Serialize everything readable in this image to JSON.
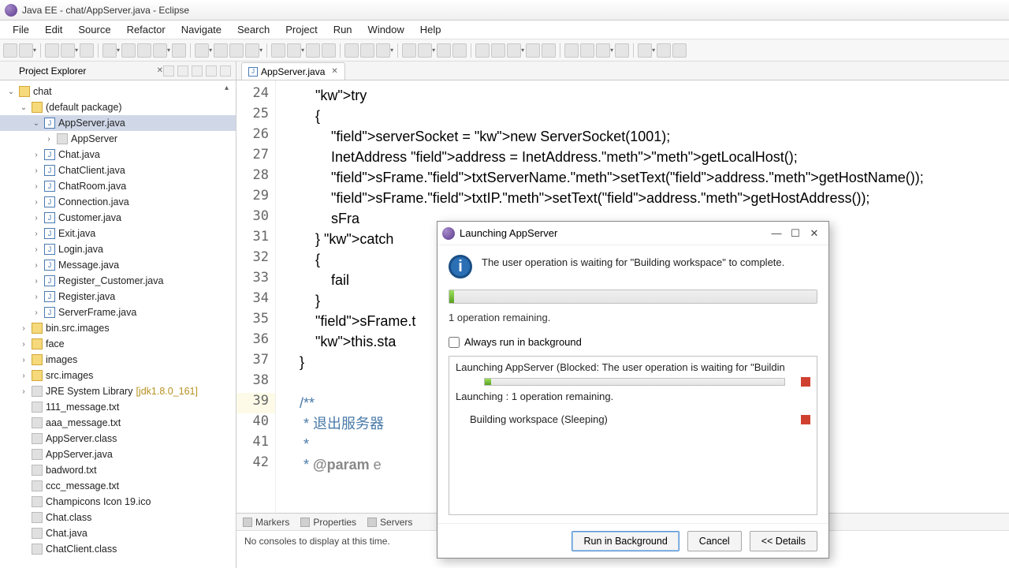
{
  "window": {
    "title": "Java EE - chat/AppServer.java - Eclipse"
  },
  "menu": [
    "File",
    "Edit",
    "Source",
    "Refactor",
    "Navigate",
    "Search",
    "Project",
    "Run",
    "Window",
    "Help"
  ],
  "sidebar": {
    "title": "Project Explorer",
    "tree": [
      {
        "d": 0,
        "tw": "v",
        "t": "folder",
        "lbl": "chat"
      },
      {
        "d": 1,
        "tw": "v",
        "t": "folder",
        "lbl": "(default package)"
      },
      {
        "d": 2,
        "tw": "v",
        "t": "java",
        "lbl": "AppServer.java",
        "sel": true
      },
      {
        "d": 3,
        "tw": "›",
        "t": "class",
        "lbl": "AppServer"
      },
      {
        "d": 2,
        "tw": "›",
        "t": "java",
        "lbl": "Chat.java"
      },
      {
        "d": 2,
        "tw": "›",
        "t": "java",
        "lbl": "ChatClient.java"
      },
      {
        "d": 2,
        "tw": "›",
        "t": "java",
        "lbl": "ChatRoom.java"
      },
      {
        "d": 2,
        "tw": "›",
        "t": "java",
        "lbl": "Connection.java"
      },
      {
        "d": 2,
        "tw": "›",
        "t": "java",
        "lbl": "Customer.java"
      },
      {
        "d": 2,
        "tw": "›",
        "t": "java",
        "lbl": "Exit.java"
      },
      {
        "d": 2,
        "tw": "›",
        "t": "java",
        "lbl": "Login.java"
      },
      {
        "d": 2,
        "tw": "›",
        "t": "java",
        "lbl": "Message.java"
      },
      {
        "d": 2,
        "tw": "›",
        "t": "java",
        "lbl": "Register_Customer.java"
      },
      {
        "d": 2,
        "tw": "›",
        "t": "java",
        "lbl": "Register.java"
      },
      {
        "d": 2,
        "tw": "›",
        "t": "java",
        "lbl": "ServerFrame.java"
      },
      {
        "d": 1,
        "tw": "›",
        "t": "folder",
        "lbl": "bin.src.images"
      },
      {
        "d": 1,
        "tw": "›",
        "t": "folder",
        "lbl": "face"
      },
      {
        "d": 1,
        "tw": "›",
        "t": "folder",
        "lbl": "images"
      },
      {
        "d": 1,
        "tw": "›",
        "t": "folder",
        "lbl": "src.images"
      },
      {
        "d": 1,
        "tw": "›",
        "t": "lib",
        "lbl": "JRE System Library",
        "sub": "[jdk1.8.0_161]"
      },
      {
        "d": 1,
        "tw": "",
        "t": "file",
        "lbl": "111_message.txt"
      },
      {
        "d": 1,
        "tw": "",
        "t": "file",
        "lbl": "aaa_message.txt"
      },
      {
        "d": 1,
        "tw": "",
        "t": "file",
        "lbl": "AppServer.class"
      },
      {
        "d": 1,
        "tw": "",
        "t": "file",
        "lbl": "AppServer.java"
      },
      {
        "d": 1,
        "tw": "",
        "t": "file",
        "lbl": "badword.txt"
      },
      {
        "d": 1,
        "tw": "",
        "t": "file",
        "lbl": "ccc_message.txt"
      },
      {
        "d": 1,
        "tw": "",
        "t": "file",
        "lbl": "Champicons Icon 19.ico"
      },
      {
        "d": 1,
        "tw": "",
        "t": "file",
        "lbl": "Chat.class"
      },
      {
        "d": 1,
        "tw": "",
        "t": "file",
        "lbl": "Chat.java"
      },
      {
        "d": 1,
        "tw": "",
        "t": "file",
        "lbl": "ChatClient.class"
      }
    ]
  },
  "editor": {
    "tab": "AppServer.java",
    "startLine": 24,
    "lines": [
      "        try",
      "        {",
      "            serverSocket = new ServerSocket(1001);",
      "            InetAddress address = InetAddress.getLocalHost();",
      "            sFrame.txtServerName.setText(address.getHostName());",
      "            sFrame.txtIP.setText(address.getHostAddress());",
      "            sFra",
      "        } catch ",
      "        {",
      "            fail",
      "        }",
      "        sFrame.t",
      "        this.sta",
      "    }",
      "",
      "    /**",
      "     * 退出服务器",
      "     *",
      "     * @param e"
    ]
  },
  "bottom": {
    "tabs": [
      "Markers",
      "Properties",
      "Servers"
    ],
    "msg": "No consoles to display at this time."
  },
  "dialog": {
    "title": "Launching AppServer",
    "message": "The user operation is waiting for \"Building workspace\" to complete.",
    "remaining": "1 operation remaining.",
    "checkbox": "Always run in background",
    "op1": "Launching AppServer (Blocked: The user operation is waiting for \"Buildin",
    "op1b": "Launching : 1 operation remaining.",
    "op2": "Building workspace (Sleeping)",
    "btn_run": "Run in Background",
    "btn_cancel": "Cancel",
    "btn_details": "<< Details"
  }
}
